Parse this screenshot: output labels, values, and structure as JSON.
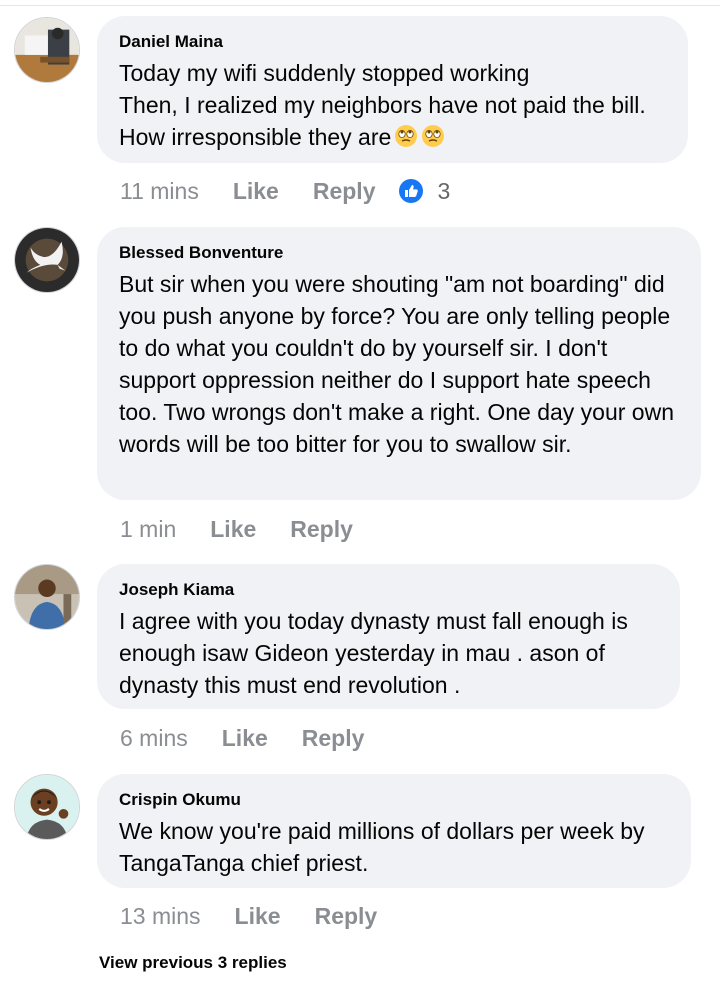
{
  "comments": [
    {
      "author": "Daniel Maina",
      "text": "Today my wifi suddenly stopped working\nThen, I realized my neighbors have not paid the bill.\nHow irresponsible they are",
      "emoji": [
        "face-with-rolling-eyes",
        "face-with-rolling-eyes"
      ],
      "time": "11 mins",
      "like_label": "Like",
      "reply_label": "Reply",
      "reaction_icon": "like-thumbs-up-icon",
      "reaction_count": "3"
    },
    {
      "author": "Blessed Bonventure",
      "text": "But sir when you were shouting \"am not boarding\" did you push anyone by force? You are only telling people to do what you couldn't do by yourself sir. I don't support oppression neither do I support hate speech too. Two wrongs don't make a right. One day your own words will be too bitter for you to swallow sir.",
      "time": "1 min",
      "like_label": "Like",
      "reply_label": "Reply"
    },
    {
      "author": "Joseph Kiama",
      "text": "I agree with you today  dynasty must fall enough is enough isaw Gideon yesterday  in mau . ason of dynasty this must end revolution .",
      "time": "6 mins",
      "like_label": "Like",
      "reply_label": "Reply"
    },
    {
      "author": "Crispin Okumu",
      "text": "We know you're paid millions of dollars per week by TangaTanga chief priest.",
      "time": "13 mins",
      "like_label": "Like",
      "reply_label": "Reply"
    }
  ],
  "view_previous_label": "View previous 3 replies",
  "colors": {
    "bubble": "#f0f2f5",
    "meta_text": "#8a8d91",
    "like_blue": "#1877f2"
  }
}
